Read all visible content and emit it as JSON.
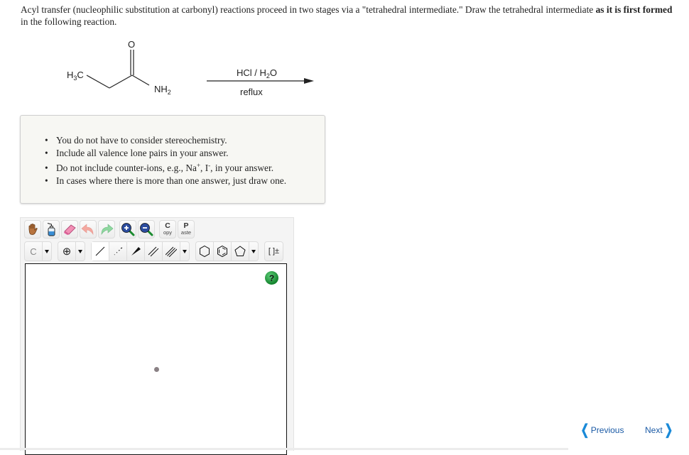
{
  "question": {
    "text_part1": "Acyl transfer (nucleophilic substitution at carbonyl) reactions proceed in two stages via a \"tetrahedral intermediate.\" Draw the tetrahedral intermediate ",
    "text_bold": "as it is first formed",
    "text_part2": " in the following reaction."
  },
  "reaction": {
    "reactant_labels": {
      "methyl": "H3C",
      "oxygen": "O",
      "amine": "NH2"
    },
    "reagent_top": "HCl / H2O",
    "reagent_bottom": "reflux"
  },
  "notes": {
    "items": [
      "You do not have to consider stereochemistry.",
      "Include all valence lone pairs in your answer.",
      "Do not include counter-ions, e.g., Na+, I-, in your answer.",
      "In cases where there is more than one answer, just draw one."
    ],
    "item3": {
      "pre": "Do not include counter-ions, e.g., Na",
      "sup1": "+",
      "mid": ", I",
      "sup2": "-",
      "post": ", in your answer."
    }
  },
  "editor": {
    "toolbar1": [
      {
        "name": "hand-tool",
        "icon": "hand-icon"
      },
      {
        "name": "lone-pair-tool",
        "icon": "wash-bottle-icon"
      },
      {
        "name": "eraser-tool",
        "icon": "eraser-icon"
      },
      {
        "name": "undo",
        "icon": "undo-icon"
      },
      {
        "name": "redo",
        "icon": "redo-icon"
      },
      {
        "name": "zoom-in",
        "icon": "zoom-in-icon"
      },
      {
        "name": "zoom-out",
        "icon": "zoom-out-icon"
      }
    ],
    "copy_letter": "C",
    "copy_rest": "opy",
    "paste_letter": "P",
    "paste_rest": "aste",
    "element_selected": "C",
    "charge_symbol": "⊕",
    "bracket_label": "[ ]±",
    "help_label": "?"
  },
  "nav": {
    "previous": "Previous",
    "next": "Next"
  },
  "colors": {
    "nav_text": "#1a5aa5",
    "nav_chevron": "#1a8ad8",
    "help_green": "#12822c"
  }
}
